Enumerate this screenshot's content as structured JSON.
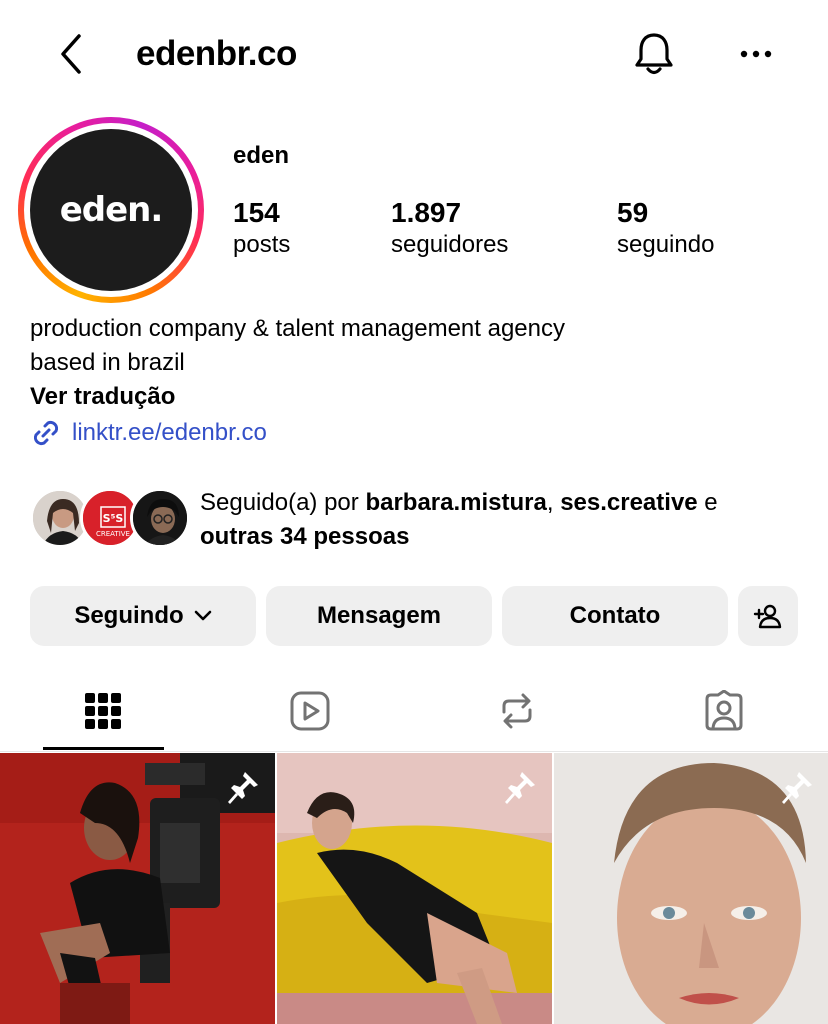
{
  "header": {
    "title": "edenbr.co"
  },
  "profile": {
    "avatar_text": "eden.",
    "name": "eden",
    "stats": [
      {
        "value": "154",
        "label": "posts"
      },
      {
        "value": "1.897",
        "label": "seguidores"
      },
      {
        "value": "59",
        "label": "seguindo"
      }
    ],
    "bio_line1": "production company & talent management agency",
    "bio_line2": "based in brazil",
    "translate": "Ver tradução",
    "link": "linktr.ee/edenbr.co"
  },
  "followed_by": {
    "prefix": "Seguido(a) por ",
    "user1": "barbara.mistura",
    "sep": ", ",
    "user2": "ses.creative",
    "conj": " e",
    "others": "outras 34 pessoas",
    "mini_avatar_text": "S⁵S CREATIVE"
  },
  "actions": {
    "following": "Seguindo",
    "message": "Mensagem",
    "contact": "Contato"
  },
  "tabs": [
    "grid",
    "reels",
    "reposts",
    "tagged"
  ],
  "icons": {
    "back": "chevron-left-icon",
    "bell": "bell-icon",
    "more": "more-horizontal-icon",
    "link": "link-icon",
    "chevron": "chevron-down-icon",
    "add_person": "add-person-icon",
    "pin": "pin-icon"
  },
  "colors": {
    "link": "#3450c8",
    "button_bg": "#efefef",
    "avatar_bg": "#1c1c1c",
    "post1_bg": "#b3231c",
    "post2_bg": "#e3c21a",
    "post3_bg": "#e9e6e3"
  },
  "posts": [
    {
      "pinned": true
    },
    {
      "pinned": true
    },
    {
      "pinned": true
    }
  ]
}
